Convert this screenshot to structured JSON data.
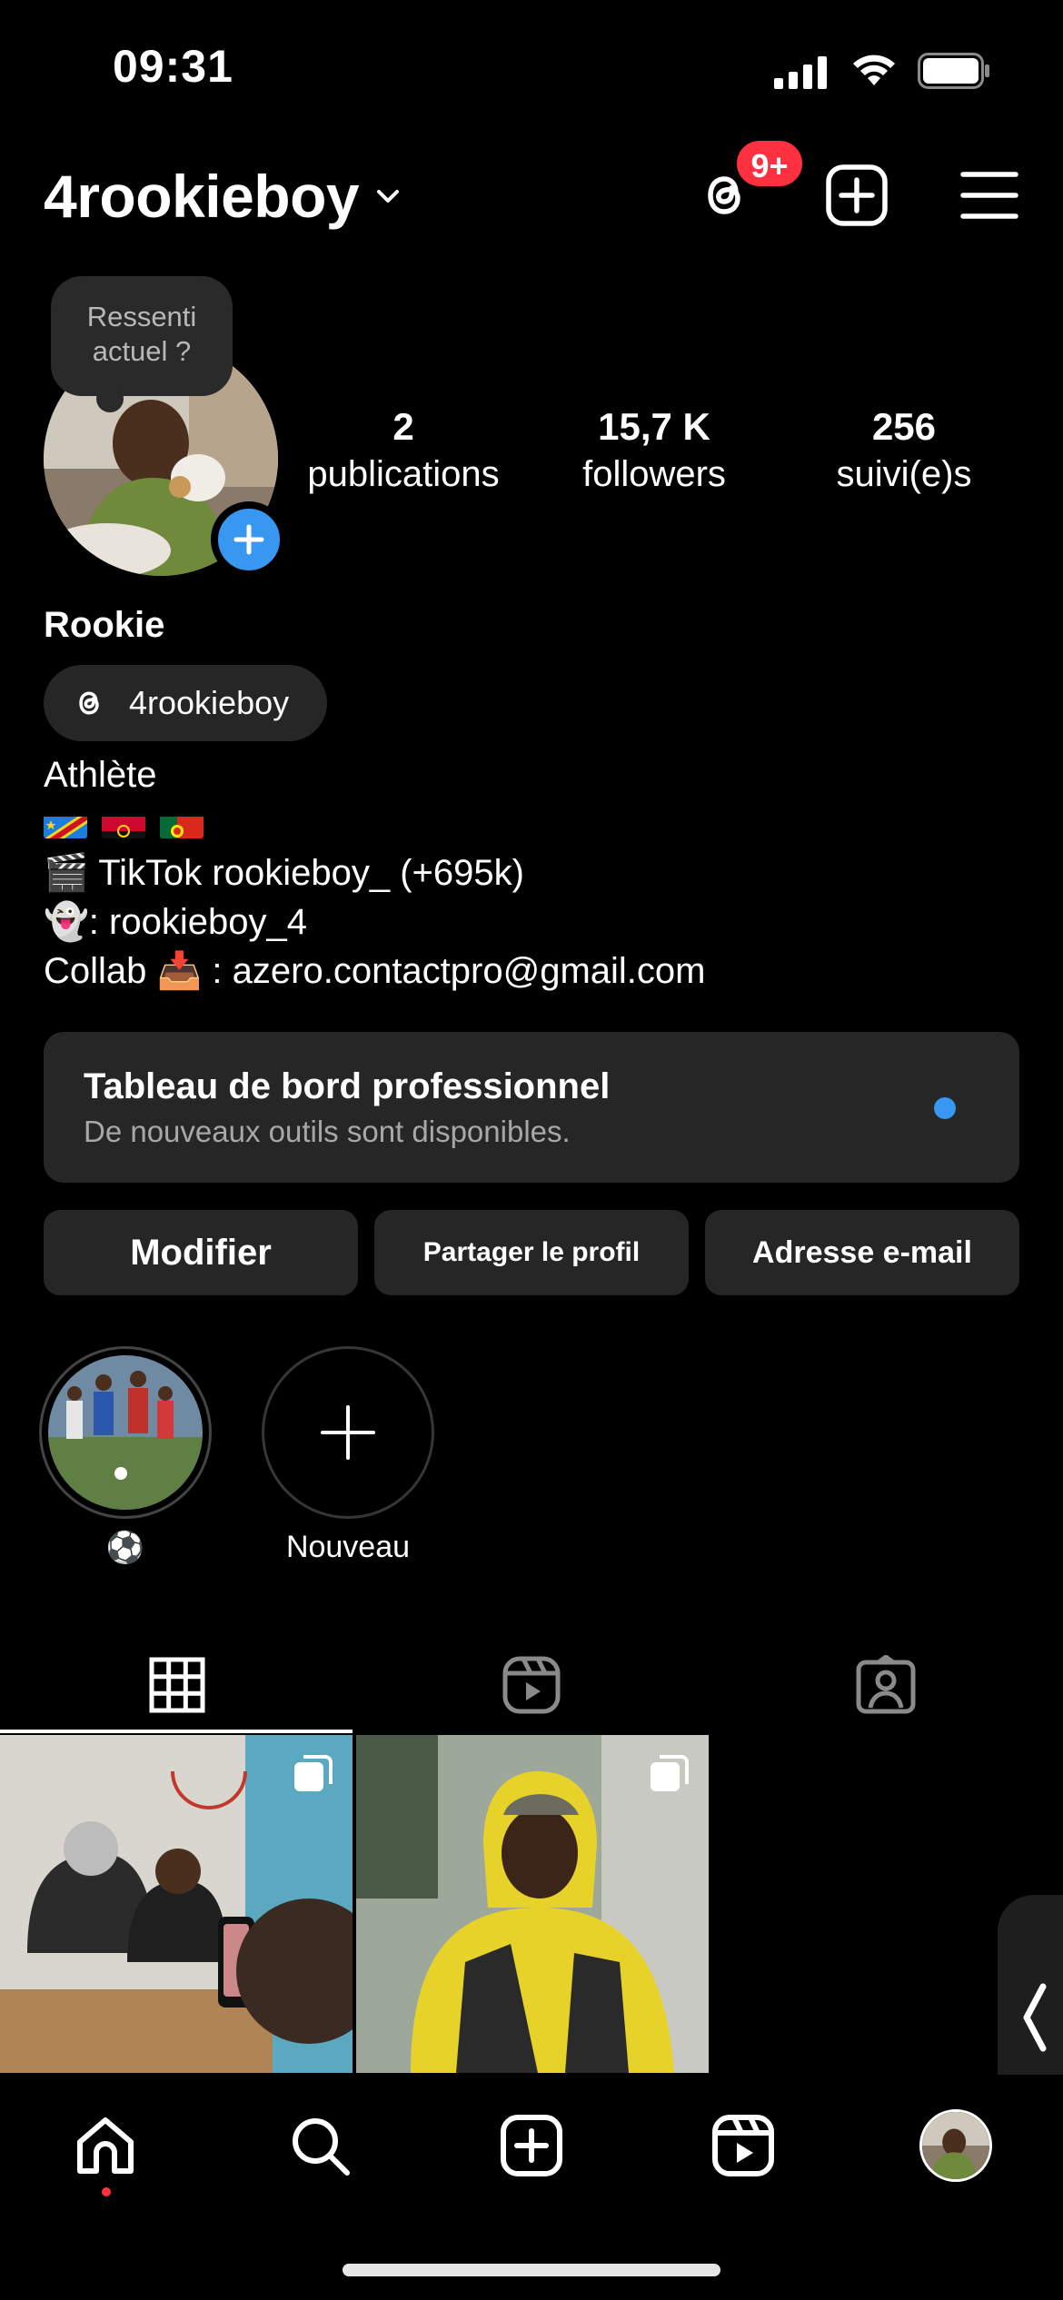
{
  "status_bar": {
    "time": "09:31"
  },
  "header": {
    "username": "4rookieboy",
    "threads_badge": "9+",
    "icons": [
      "threads-icon",
      "add-post-icon",
      "menu-icon"
    ]
  },
  "profile": {
    "note_placeholder": "Ressenti actuel ?",
    "display_name": "Rookie",
    "threads_handle": "4rookieboy",
    "stats": [
      {
        "value": "2",
        "label": "publications"
      },
      {
        "value": "15,7 K",
        "label": "followers"
      },
      {
        "value": "256",
        "label": "suivi(e)s"
      }
    ],
    "bio": {
      "category": "Athlète",
      "flags": [
        "DR Congo flag",
        "Angola flag",
        "Portugal flag"
      ],
      "line_tiktok": "🎬 TikTok rookieboy_ (+695k)",
      "line_snap": "👻: rookieboy_4",
      "line_collab": "Collab 📥 : azero.contactpro@gmail.com"
    }
  },
  "dashboard": {
    "title": "Tableau de bord professionnel",
    "subtitle": "De nouveaux outils sont disponibles."
  },
  "actions": {
    "edit": "Modifier",
    "share": "Partager le profil",
    "email": "Adresse e-mail"
  },
  "highlights": [
    {
      "label": "⚽"
    },
    {
      "label": "Nouveau"
    }
  ],
  "tabs": [
    "grid-icon",
    "reels-icon",
    "tagged-icon"
  ],
  "bottom_nav": [
    "home-icon",
    "search-icon",
    "create-icon",
    "reels-icon",
    "profile-avatar"
  ],
  "colors": {
    "background": "#000000",
    "card": "#262626",
    "accent_blue": "#3897f0",
    "badge_red": "#ff3040"
  }
}
